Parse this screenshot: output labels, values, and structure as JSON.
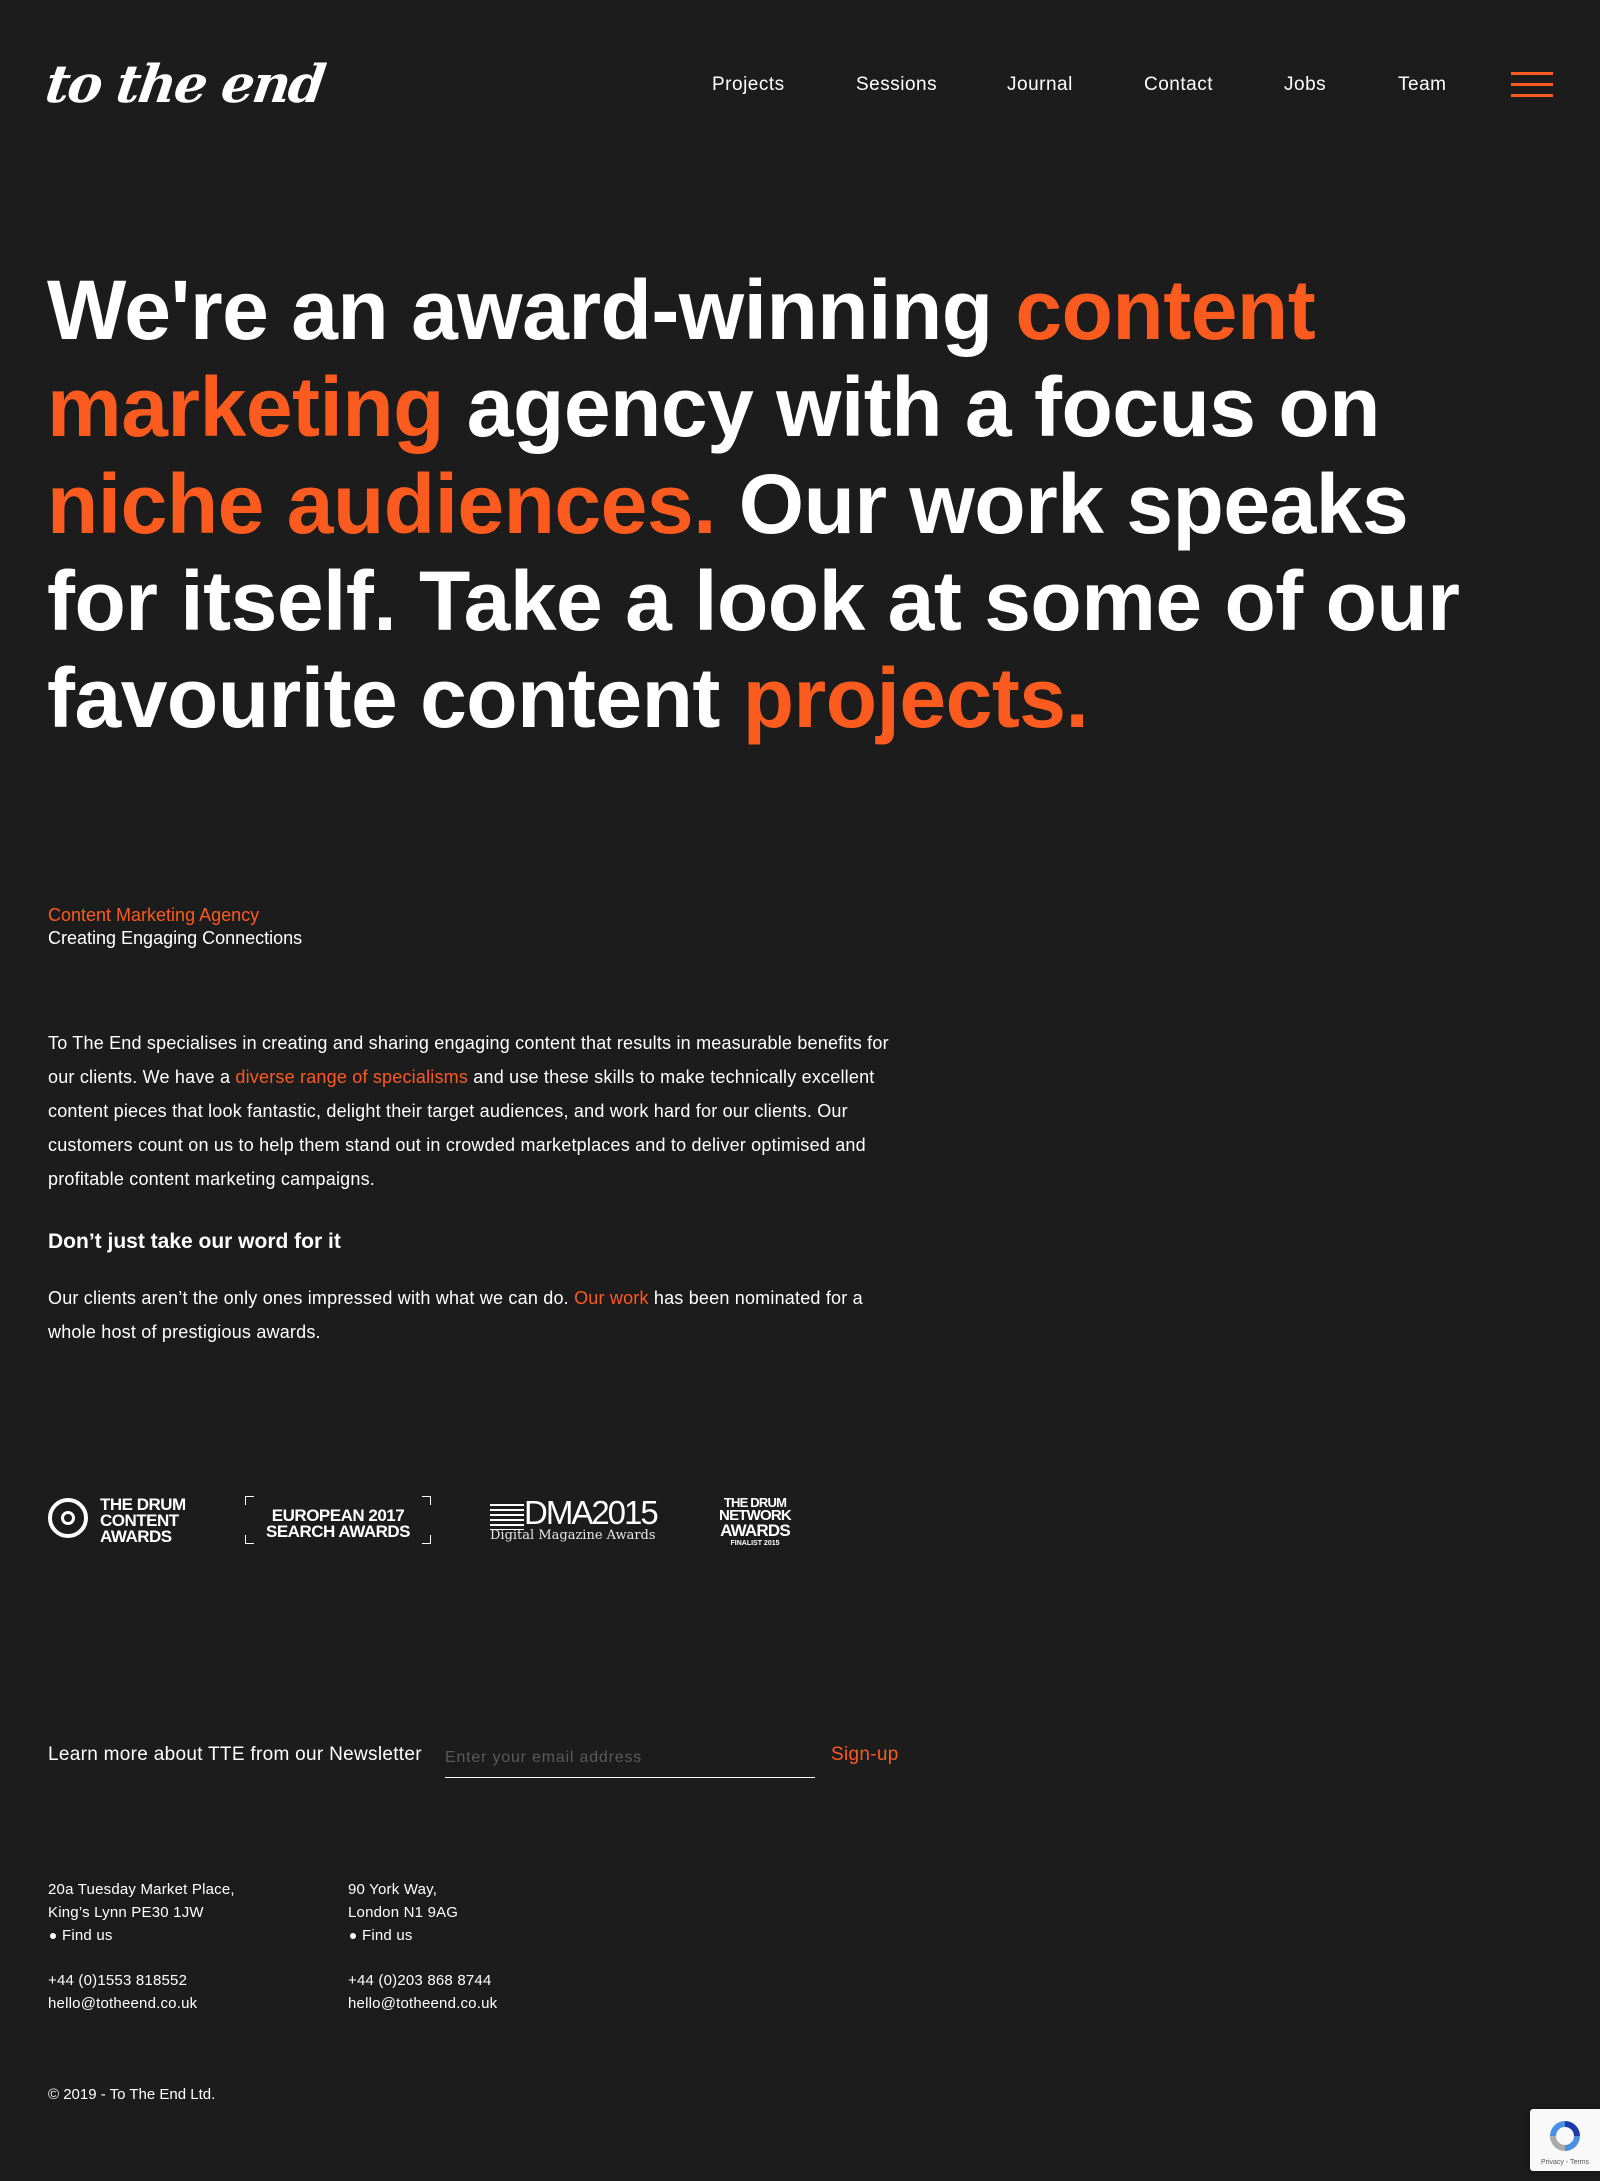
{
  "header": {
    "logo_text": "to the end",
    "nav": [
      "Projects",
      "Sessions",
      "Journal",
      "Contact",
      "Jobs",
      "Team"
    ]
  },
  "hero": {
    "p1": "We're an award-winning ",
    "p2": "content marketing",
    "p3": " agency with a focus on ",
    "p4": "niche audiences.",
    "p5": " Our work speaks for itself. Take a look at some of our favourite content ",
    "p6": "projects."
  },
  "intro": {
    "kicker": "Content Marketing Agency",
    "kicker_sub": "Creating Engaging Connections",
    "para1_a": "To The End specialises in creating and sharing engaging content that results in measurable benefits for our clients. We have a ",
    "para1_link": "diverse range of specialisms",
    "para1_b": " and use these skills to make technically excellent content pieces that look fantastic, delight their target audiences, and work hard for our clients. Our customers count on us to help them stand out in crowded marketplaces and to deliver optimised and profitable content marketing campaigns.",
    "heading": "Don’t just take our word for it",
    "para2_a": "Our clients aren’t the only ones impressed with what we can do. ",
    "para2_link": "Our work",
    "para2_b": " has been nominated for a whole host of prestigious awards."
  },
  "awards": {
    "drum_content": [
      "THE DRUM",
      "CONTENT",
      "AWARDS"
    ],
    "european": [
      "EUROPEAN 2017",
      "SEARCH AWARDS"
    ],
    "dma": [
      "DMA2015",
      "Digital Magazine Awards"
    ],
    "drum_network": [
      "THE DRUM",
      "NETWORK",
      "AWARDS",
      "FINALIST 2015"
    ]
  },
  "newsletter": {
    "label": "Learn more about TTE from our Newsletter",
    "placeholder": "Enter your email address",
    "button": "Sign-up"
  },
  "offices": [
    {
      "line1": "20a Tuesday Market Place,",
      "line2": "King’s Lynn PE30 1JW",
      "find": "Find us",
      "phone": "+44 (0)1553 818552",
      "email": "hello@totheend.co.uk"
    },
    {
      "line1": "90 York Way,",
      "line2": "London N1 9AG",
      "find": "Find us",
      "phone": "+44 (0)203 868 8744",
      "email": "hello@totheend.co.uk"
    }
  ],
  "copyright": "© 2019 - To The End Ltd.",
  "recaptcha_text": "Privacy - Terms",
  "colors": {
    "background": "#1c1c1c",
    "accent": "#fc5b20",
    "text": "#ffffff"
  }
}
